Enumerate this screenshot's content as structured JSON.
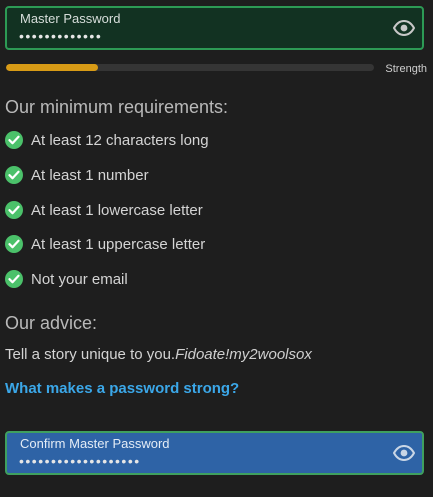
{
  "master_password": {
    "label": "Master Password",
    "value": "•••••••••••••",
    "reveal_icon": "eye-icon"
  },
  "strength": {
    "label": "Strength",
    "level_percent": 25,
    "color": "#d89b16"
  },
  "requirements": {
    "heading": "Our minimum requirements:",
    "items": [
      {
        "label": "At least 12 characters long",
        "met": true
      },
      {
        "label": "At least 1 number",
        "met": true
      },
      {
        "label": "At least 1 lowercase letter",
        "met": true
      },
      {
        "label": "At least 1 uppercase letter",
        "met": true
      },
      {
        "label": "Not your email",
        "met": true
      }
    ],
    "check_color": "#4bc16a"
  },
  "advice": {
    "heading": "Our advice:",
    "text": "Tell a story unique to you.",
    "example": "Fidoate!my2woolsox",
    "link": "What makes a password strong?"
  },
  "confirm_password": {
    "label": "Confirm Master Password",
    "value": "•••••••••••••••••••",
    "reveal_icon": "eye-icon"
  }
}
